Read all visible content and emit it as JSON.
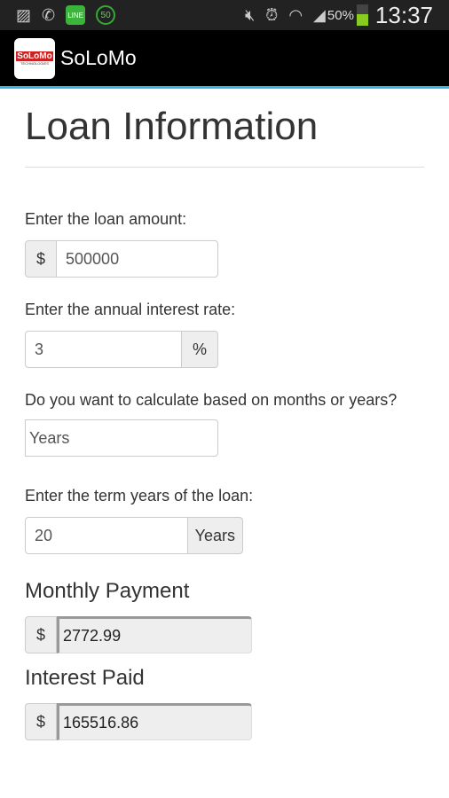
{
  "status_bar": {
    "battery": "50%",
    "time": "13:37",
    "icons": [
      "image-icon",
      "whatsapp-icon",
      "line-icon",
      "counter-50-icon",
      "mute-icon",
      "alarm-icon",
      "wifi-icon",
      "signal-icon",
      "battery-icon"
    ],
    "counter": "50",
    "line_label": "LINE"
  },
  "app_bar": {
    "title": "SoLoMo",
    "logo_text": "SoLoMo",
    "logo_sub": "TECHNOLOGIES"
  },
  "page": {
    "title": "Loan Information"
  },
  "form": {
    "amount_label": "Enter the loan amount:",
    "amount_prefix": "$",
    "amount_value": "500000",
    "rate_label": "Enter the annual interest rate:",
    "rate_value": "3",
    "rate_suffix": "%",
    "period_label": "Do you want to calculate based on months or years?",
    "period_value": "Years",
    "term_label": "Enter the term years of the loan:",
    "term_value": "20",
    "term_suffix": "Years"
  },
  "results": {
    "monthly_title": "Monthly Payment",
    "monthly_prefix": "$",
    "monthly_value": "2772.99",
    "interest_title": "Interest Paid",
    "interest_prefix": "$",
    "interest_value": "165516.86"
  }
}
